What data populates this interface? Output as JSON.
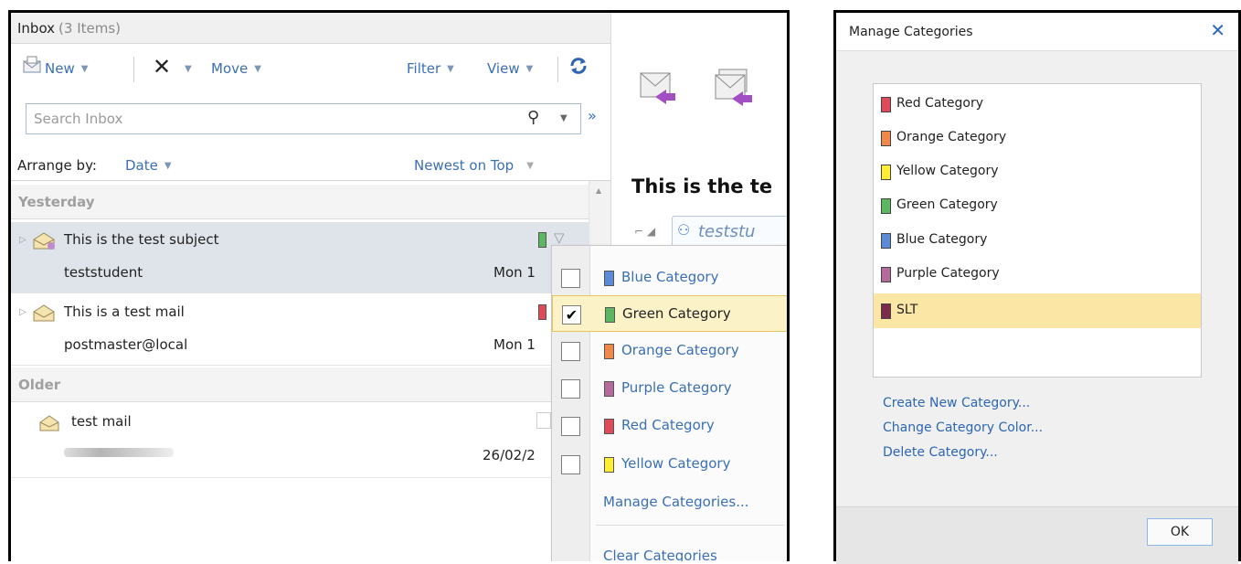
{
  "inbox": {
    "title": "Inbox",
    "count": "(3 Items)",
    "toolbar": {
      "new_label": "New",
      "move_label": "Move",
      "filter_label": "Filter",
      "view_label": "View"
    },
    "search_placeholder": "Search Inbox",
    "arrange_label": "Arrange by:",
    "arrange_value": "Date",
    "sort_label": "Newest on Top",
    "groups": {
      "yesterday": "Yesterday",
      "older": "Older"
    },
    "messages": [
      {
        "subject": "This is the test subject",
        "from": "teststudent",
        "date": "Mon 1"
      },
      {
        "subject": "This is a test mail",
        "from": "postmaster@local",
        "date": "Mon 1"
      },
      {
        "subject": "test mail",
        "from": "",
        "date": "26/02/2"
      }
    ]
  },
  "reading": {
    "subject": "This is the te",
    "sender": "teststu"
  },
  "menu": {
    "items": [
      {
        "label": "Blue Category",
        "color": "#5b8ad6",
        "checked": ""
      },
      {
        "label": "Green Category",
        "color": "#5cb860",
        "checked": "✔"
      },
      {
        "label": "Orange Category",
        "color": "#f0884a",
        "checked": ""
      },
      {
        "label": "Purple Category",
        "color": "#b46a9a",
        "checked": ""
      },
      {
        "label": "Red Category",
        "color": "#e04b5c",
        "checked": ""
      },
      {
        "label": "Yellow Category",
        "color": "#ffee33",
        "checked": ""
      }
    ],
    "manage_label": "Manage Categories...",
    "clear_label": "Clear Categories"
  },
  "dialog": {
    "title": "Manage Categories",
    "categories": [
      {
        "label": "Red Category",
        "color": "#e04b5c"
      },
      {
        "label": "Orange Category",
        "color": "#f0884a"
      },
      {
        "label": "Yellow Category",
        "color": "#ffee33"
      },
      {
        "label": "Green Category",
        "color": "#5cb860"
      },
      {
        "label": "Blue Category",
        "color": "#5b8ad6"
      },
      {
        "label": "Purple Category",
        "color": "#b46a9a"
      },
      {
        "label": "SLT",
        "color": "#7a2b4c"
      }
    ],
    "create_label": "Create New Category...",
    "change_label": "Change Category Color...",
    "delete_label": "Delete Category...",
    "ok_label": "OK"
  }
}
